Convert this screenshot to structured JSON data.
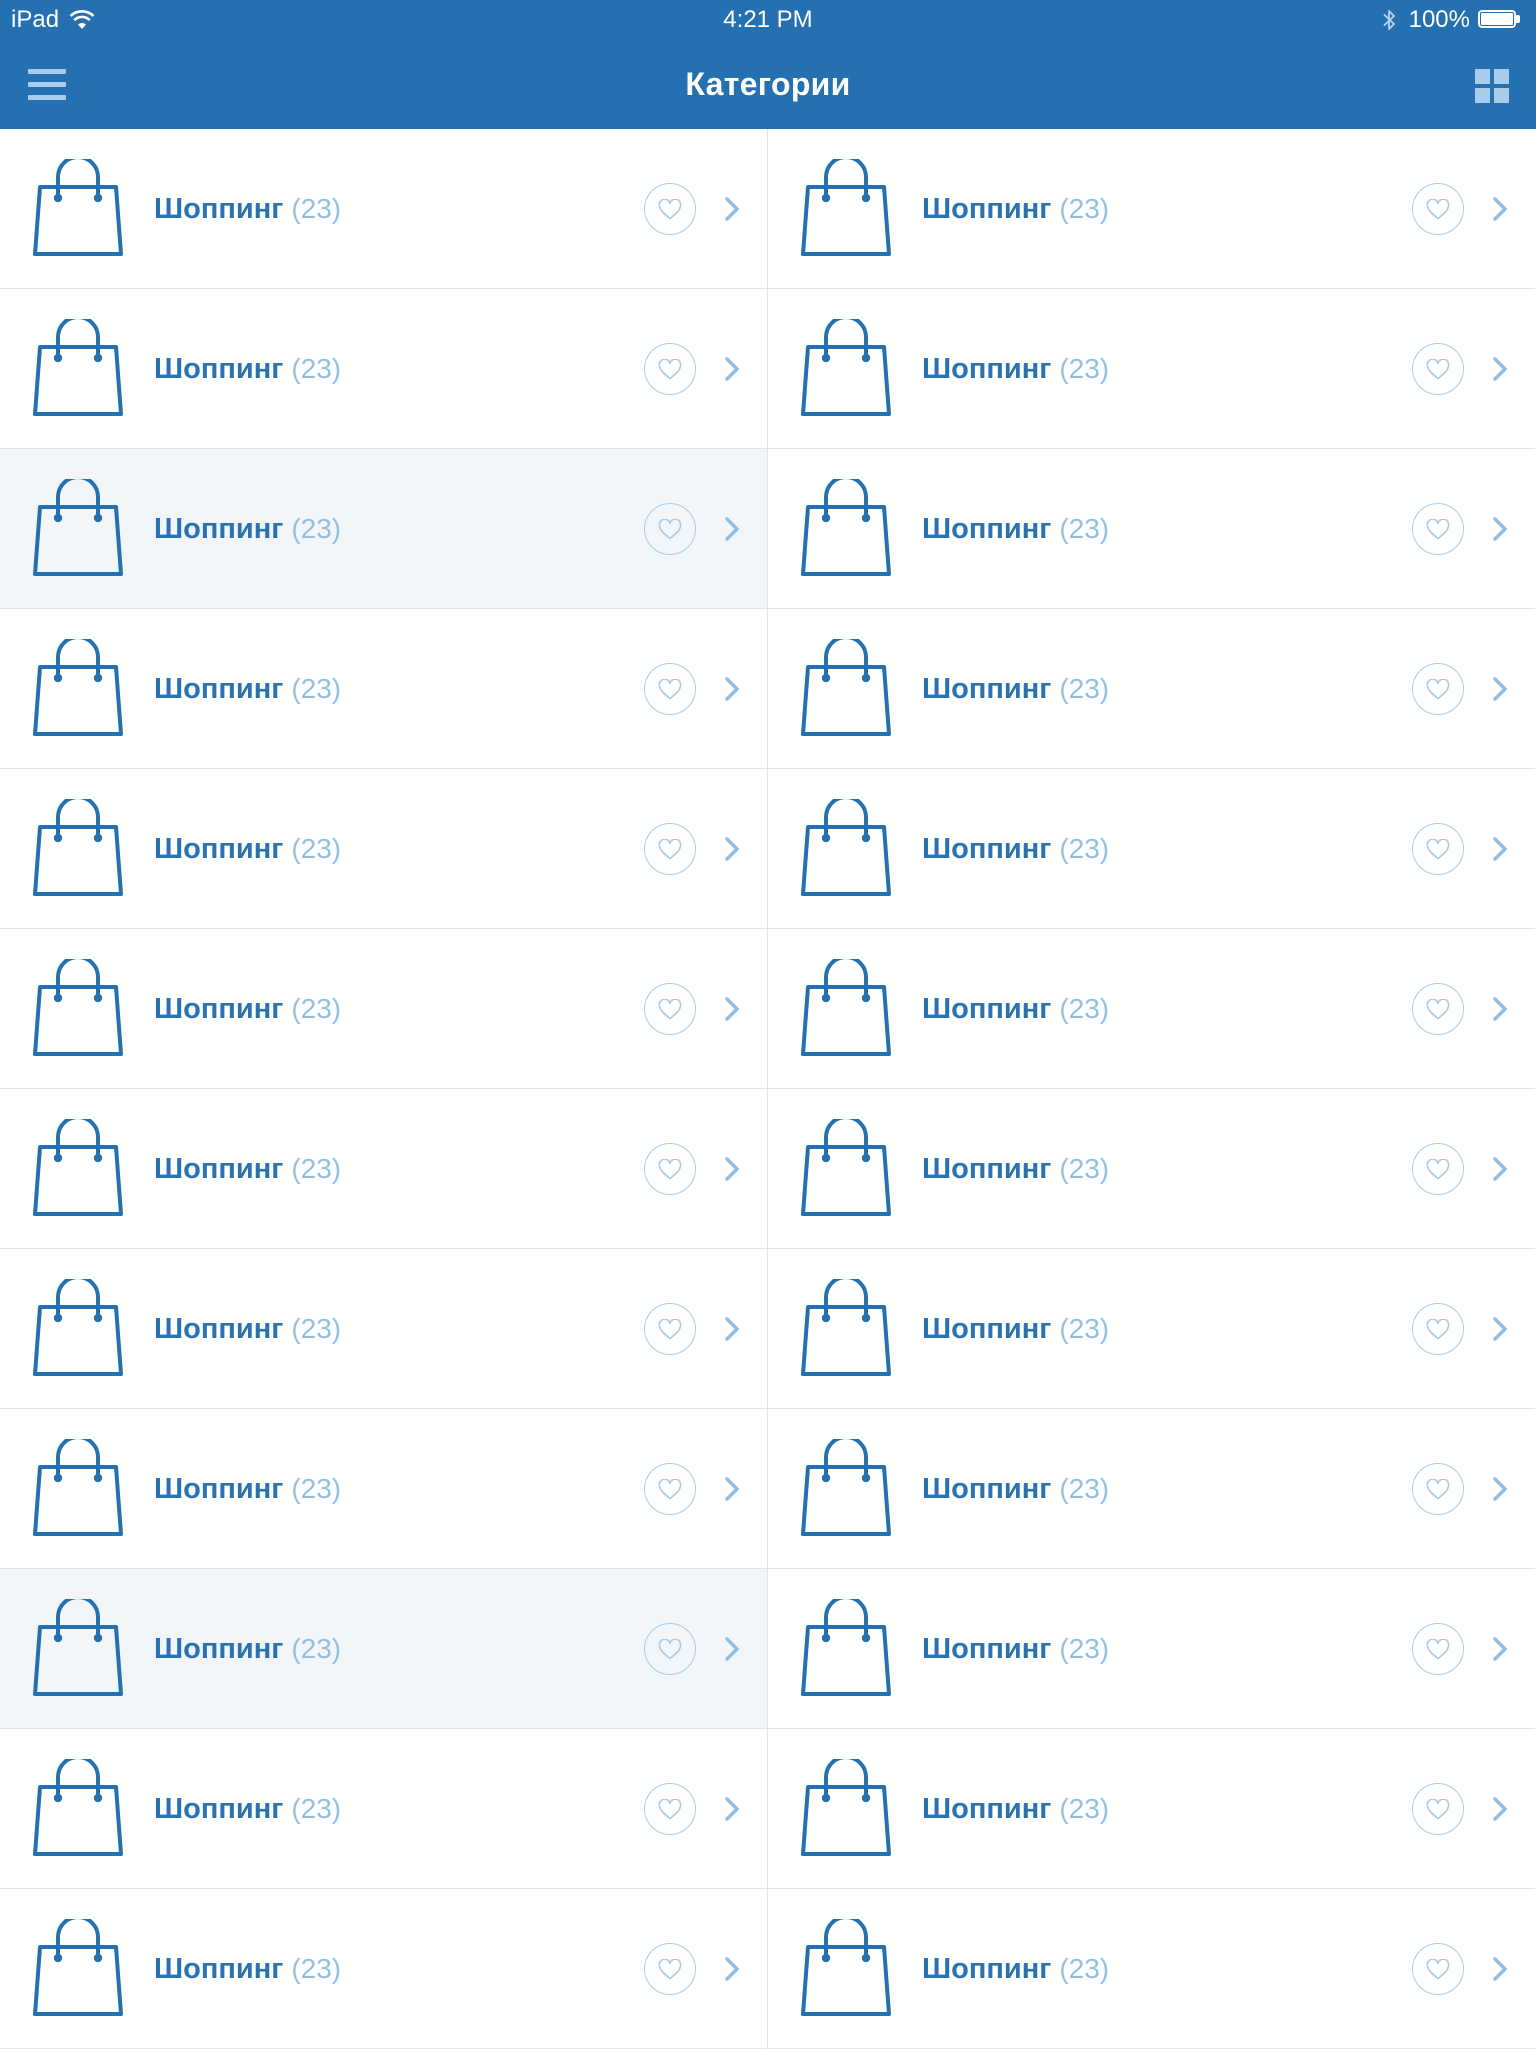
{
  "status_bar": {
    "device": "iPad",
    "time": "4:21 PM",
    "battery": "100%",
    "battery_level": 1.0
  },
  "nav": {
    "title": "Категории",
    "menu_icon": "hamburger-menu-icon",
    "view_toggle_icon": "grid-view-icon"
  },
  "colors": {
    "header": "#2570b0",
    "accent": "#2a72b2",
    "muted": "#94bfe3",
    "selected_row": "#f3f6f9"
  },
  "categories": [
    {
      "name": "Шоппинг",
      "count": "(23)",
      "icon": "shopping-bag-icon",
      "selected": false
    },
    {
      "name": "Шоппинг",
      "count": "(23)",
      "icon": "shopping-bag-icon",
      "selected": false
    },
    {
      "name": "Шоппинг",
      "count": "(23)",
      "icon": "shopping-bag-icon",
      "selected": false
    },
    {
      "name": "Шоппинг",
      "count": "(23)",
      "icon": "shopping-bag-icon",
      "selected": false
    },
    {
      "name": "Шоппинг",
      "count": "(23)",
      "icon": "shopping-bag-icon",
      "selected": true
    },
    {
      "name": "Шоппинг",
      "count": "(23)",
      "icon": "shopping-bag-icon",
      "selected": false
    },
    {
      "name": "Шоппинг",
      "count": "(23)",
      "icon": "shopping-bag-icon",
      "selected": false
    },
    {
      "name": "Шоппинг",
      "count": "(23)",
      "icon": "shopping-bag-icon",
      "selected": false
    },
    {
      "name": "Шоппинг",
      "count": "(23)",
      "icon": "shopping-bag-icon",
      "selected": false
    },
    {
      "name": "Шоппинг",
      "count": "(23)",
      "icon": "shopping-bag-icon",
      "selected": false
    },
    {
      "name": "Шоппинг",
      "count": "(23)",
      "icon": "shopping-bag-icon",
      "selected": false
    },
    {
      "name": "Шоппинг",
      "count": "(23)",
      "icon": "shopping-bag-icon",
      "selected": false
    },
    {
      "name": "Шоппинг",
      "count": "(23)",
      "icon": "shopping-bag-icon",
      "selected": false
    },
    {
      "name": "Шоппинг",
      "count": "(23)",
      "icon": "shopping-bag-icon",
      "selected": false
    },
    {
      "name": "Шоппинг",
      "count": "(23)",
      "icon": "shopping-bag-icon",
      "selected": false
    },
    {
      "name": "Шоппинг",
      "count": "(23)",
      "icon": "shopping-bag-icon",
      "selected": false
    },
    {
      "name": "Шоппинг",
      "count": "(23)",
      "icon": "shopping-bag-icon",
      "selected": false
    },
    {
      "name": "Шоппинг",
      "count": "(23)",
      "icon": "shopping-bag-icon",
      "selected": false
    },
    {
      "name": "Шоппинг",
      "count": "(23)",
      "icon": "shopping-bag-icon",
      "selected": true
    },
    {
      "name": "Шоппинг",
      "count": "(23)",
      "icon": "shopping-bag-icon",
      "selected": false
    },
    {
      "name": "Шоппинг",
      "count": "(23)",
      "icon": "shopping-bag-icon",
      "selected": false
    },
    {
      "name": "Шоппинг",
      "count": "(23)",
      "icon": "shopping-bag-icon",
      "selected": false
    },
    {
      "name": "Шоппинг",
      "count": "(23)",
      "icon": "shopping-bag-icon",
      "selected": false
    },
    {
      "name": "Шоппинг",
      "count": "(23)",
      "icon": "shopping-bag-icon",
      "selected": false
    }
  ]
}
